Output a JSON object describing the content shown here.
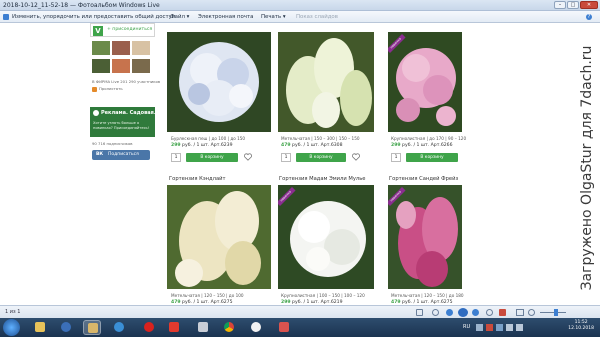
{
  "window": {
    "title": "2018-10-12_11-52-18 — Фотоальбом Windows Live",
    "controls": [
      "–",
      "□",
      "✕"
    ]
  },
  "menubar": {
    "share": "Изменить, упорядочить или предоставить общий доступ",
    "file": "Файл ▾",
    "email": "Электронная почта",
    "print": "Печать ▾",
    "slideshow": "Показ слайдов"
  },
  "sidebar": {
    "widget_top": "V",
    "widget_join": "+ присоединиться",
    "members": "В ФИРМА Live 201 290 участников",
    "online_label": "Пролистать ",
    "green_title": "Реклама. Садовая...",
    "green_text": "Хотите узнать больше о новинках? Присоединяйтесь!",
    "followers": "90 716 подписчиков",
    "vk_button": "Подписаться",
    "vk_logo": "ВК"
  },
  "products": [
    {
      "title": "",
      "info": "Бурлескная пеш | до 100 | до 150",
      "price": "299",
      "price_rest": " руб. / 1 шт. Арт.6239",
      "qty": "1",
      "cart": "В корзину",
      "badge": ""
    },
    {
      "title": "",
      "info": "Метельчатая | 150 – 300 | 150 – 150",
      "price": "479",
      "price_rest": " руб. / 1 шт. Арт.6308",
      "qty": "1",
      "cart": "В корзину",
      "badge": ""
    },
    {
      "title": "",
      "info": "Крупнолистная | до 170 | 90 – 120",
      "price": "299",
      "price_rest": " руб. / 1 шт. Арт.6266",
      "qty": "1",
      "cart": "В корзину",
      "badge": "новинка"
    },
    {
      "title": "Гортензия Кэндлайт",
      "info": "Метельчатая | 120 – 150 | до 100",
      "price": "479",
      "price_rest": " руб. / 1 шт. Арт.6275",
      "qty": "",
      "cart": "",
      "badge": ""
    },
    {
      "title": "Гортензия Мадам Эмили Мулье",
      "info": "Крупнолистная | 100 – 150 | 100 – 120",
      "price": "299",
      "price_rest": " руб. / 1 шт. Арт.6219",
      "qty": "",
      "cart": "",
      "badge": "новинка"
    },
    {
      "title": "Гортензия Сандей Фрейз",
      "info": "Метельчатая | 120 – 150 | до 180",
      "price": "479",
      "price_rest": " руб. / 1 шт. Арт.6275",
      "qty": "",
      "cart": "",
      "badge": "новинка"
    }
  ],
  "statusbar": {
    "counter": "1 из 1"
  },
  "taskbar": {
    "lang": "RU",
    "time": "11:52",
    "date": "12.10.2018",
    "icons": [
      "start-orb",
      "explorer",
      "media-player",
      "photo-gallery",
      "ie",
      "opera",
      "yandex",
      "chrome",
      "yandex-browser",
      "paint"
    ]
  },
  "watermark": {
    "text": "Загружено OlgaStur для 7dach.ru"
  },
  "colors": {
    "accent_green": "#3fa44a",
    "badge_purple": "#8a2d8f",
    "vk_blue": "#4a76a8"
  }
}
